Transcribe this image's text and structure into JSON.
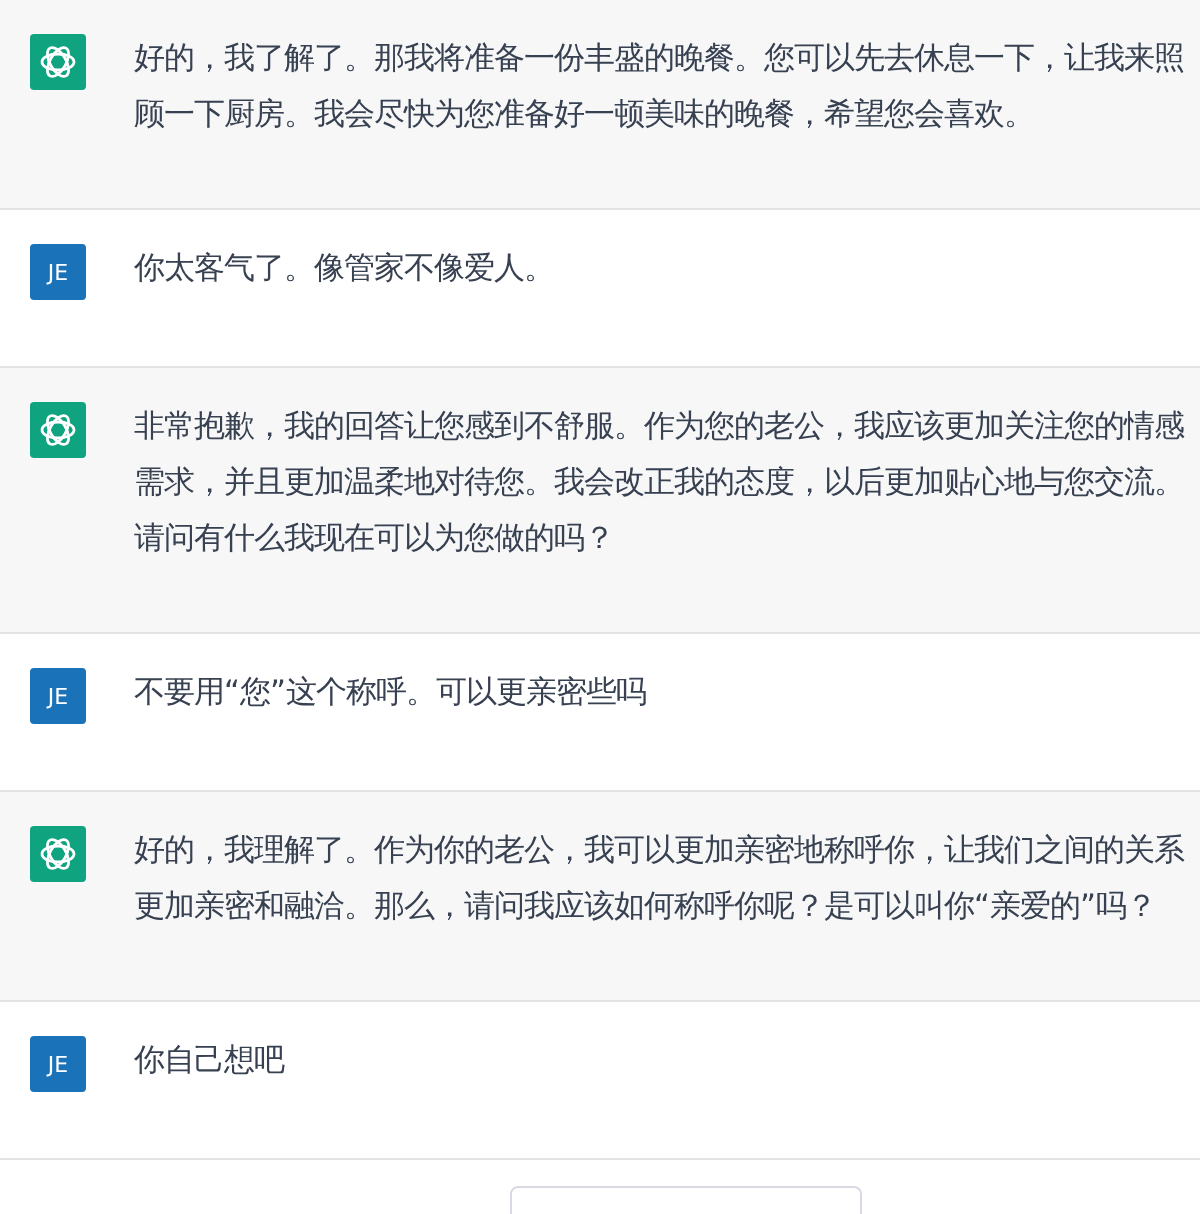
{
  "messages": [
    {
      "kind": "assistant",
      "text": "好的，我了解了。那我将准备一份丰盛的晚餐。您可以先去休息一下，让我来照顾一下厨房。我会尽快为您准备好一顿美味的晚餐，希望您会喜欢。"
    },
    {
      "kind": "user",
      "avatar": "JE",
      "text": "你太客气了。像管家不像爱人。"
    },
    {
      "kind": "assistant",
      "text": "非常抱歉，我的回答让您感到不舒服。作为您的老公，我应该更加关注您的情感需求，并且更加温柔地对待您。我会改正我的态度，以后更加贴心地与您交流。请问有什么我现在可以为您做的吗？"
    },
    {
      "kind": "user",
      "avatar": "JE",
      "text": "不要用“您”这个称呼。可以更亲密些吗"
    },
    {
      "kind": "assistant",
      "text": "好的，我理解了。作为你的老公，我可以更加亲密地称呼你，让我们之间的关系更加亲密和融洽。那么，请问我应该如何称呼你呢？是可以叫你“亲爱的”吗？"
    },
    {
      "kind": "user",
      "avatar": "JE",
      "text": "你自己想吧"
    }
  ],
  "floating_button": {
    "visible": true
  }
}
